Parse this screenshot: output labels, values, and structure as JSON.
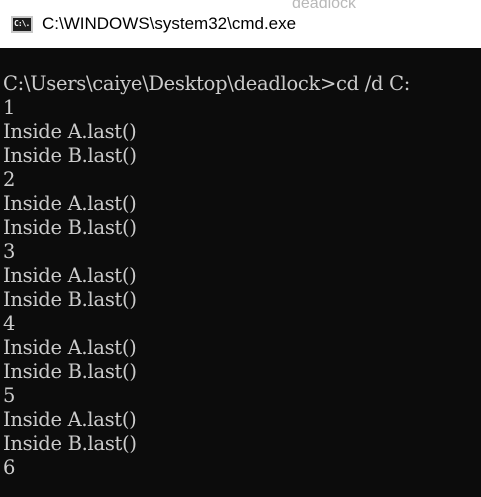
{
  "window": {
    "title": "C:\\WINDOWS\\system32\\cmd.exe",
    "icon_label": "C:\\.",
    "background_title_fragment": "deadlock"
  },
  "colors": {
    "console_bg": "#0c0c0c",
    "console_text": "#cccccc",
    "titlebar_bg": "#ffffff"
  },
  "console": {
    "lines": [
      "C:\\Users\\caiye\\Desktop\\deadlock>cd /d C:",
      "1",
      "Inside A.last()",
      "Inside B.last()",
      "2",
      "Inside A.last()",
      "Inside B.last()",
      "3",
      "Inside A.last()",
      "Inside B.last()",
      "4",
      "Inside A.last()",
      "Inside B.last()",
      "5",
      "Inside A.last()",
      "Inside B.last()",
      "6"
    ]
  }
}
